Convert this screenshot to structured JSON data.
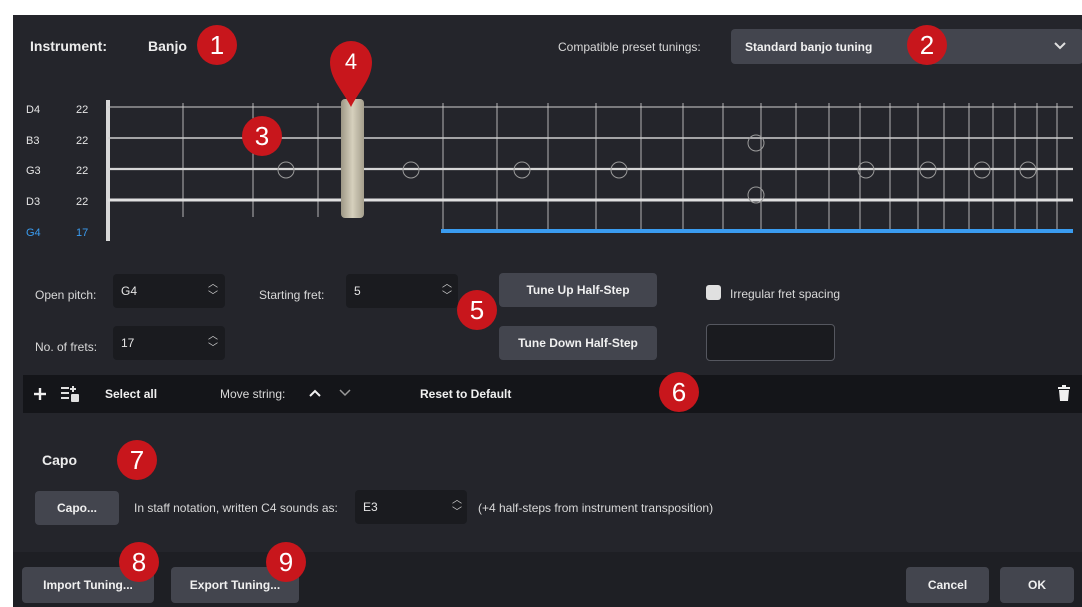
{
  "header": {
    "instrument_label": "Instrument:",
    "instrument_name": "Banjo",
    "compatible_label": "Compatible preset tunings:",
    "preset_value": "Standard banjo tuning"
  },
  "strings": [
    {
      "note": "D4",
      "frets": "22",
      "active": false
    },
    {
      "note": "B3",
      "frets": "22",
      "active": false
    },
    {
      "note": "G3",
      "frets": "22",
      "active": false
    },
    {
      "note": "D3",
      "frets": "22",
      "active": false
    },
    {
      "note": "G4",
      "frets": "17",
      "active": true
    }
  ],
  "controls": {
    "open_pitch_label": "Open pitch:",
    "open_pitch_value": "G4",
    "starting_fret_label": "Starting fret:",
    "starting_fret_value": "5",
    "frets_label": "No. of frets:",
    "frets_value": "17",
    "tune_up": "Tune Up Half-Step",
    "tune_down": "Tune Down Half-Step",
    "irregular_label": "Irregular fret spacing"
  },
  "toolbar": {
    "select_all": "Select all",
    "move_string": "Move string:",
    "reset": "Reset to Default"
  },
  "capo": {
    "heading": "Capo",
    "button": "Capo...",
    "sounds_label": "In staff notation, written C4 sounds as:",
    "sounds_value": "E3",
    "note": "(+4 half-steps from instrument transposition)"
  },
  "footer": {
    "import": "Import Tuning...",
    "export": "Export Tuning...",
    "cancel": "Cancel",
    "ok": "OK"
  },
  "callouts": [
    "1",
    "2",
    "3",
    "4",
    "5",
    "6",
    "7",
    "8",
    "9"
  ],
  "colors": {
    "background": "#24252b",
    "accent_blue": "#3a9cf0",
    "callout_red": "#c8161c",
    "button": "#43454e"
  }
}
